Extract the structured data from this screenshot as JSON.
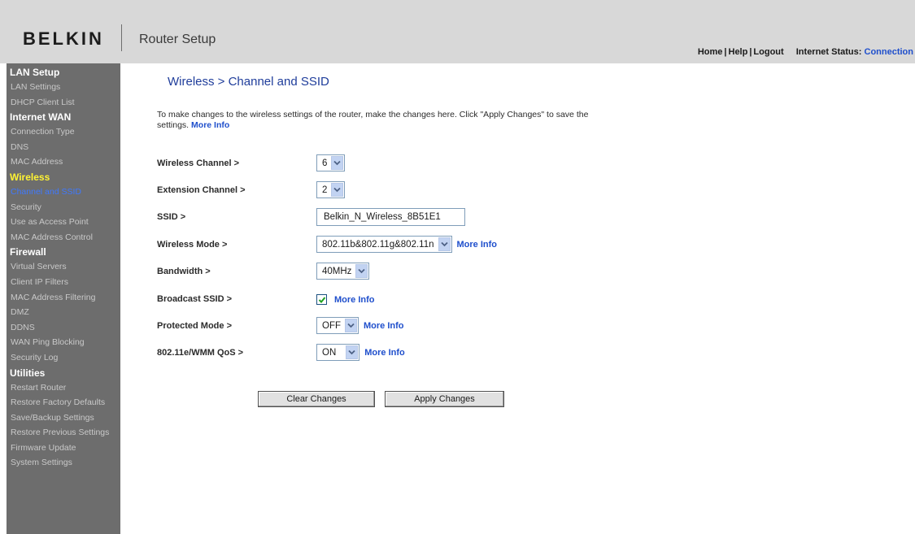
{
  "header": {
    "logo": "BELKIN",
    "title": "Router Setup",
    "nav": {
      "home": "Home",
      "help": "Help",
      "logout": "Logout",
      "separator": "|",
      "status_label": "Internet Status:",
      "status_value": "Connection"
    }
  },
  "sidebar": {
    "lan_setup": "LAN Setup",
    "lan_settings": "LAN Settings",
    "dhcp_client_list": "DHCP Client List",
    "internet_wan": "Internet WAN",
    "connection_type": "Connection Type",
    "dns": "DNS",
    "mac_address": "MAC Address",
    "wireless": "Wireless",
    "channel_and_ssid": "Channel and SSID",
    "security": "Security",
    "use_as_access_point": "Use as Access Point",
    "mac_address_control": "MAC Address Control",
    "firewall": "Firewall",
    "virtual_servers": "Virtual Servers",
    "client_ip_filters": "Client IP Filters",
    "mac_address_filtering": "MAC Address Filtering",
    "dmz": "DMZ",
    "ddns": "DDNS",
    "wan_ping_blocking": "WAN Ping Blocking",
    "security_log": "Security Log",
    "utilities": "Utilities",
    "restart_router": "Restart Router",
    "restore_factory_defaults": "Restore Factory Defaults",
    "save_backup_settings": "Save/Backup Settings",
    "restore_previous_settings": "Restore Previous Settings",
    "firmware_update": "Firmware Update",
    "system_settings": "System Settings"
  },
  "main": {
    "title": "Wireless > Channel and SSID",
    "intro": "To make changes to the wireless settings of the router, make the changes here. Click \"Apply Changes\" to save the settings.",
    "more_info": "More Info",
    "fields": {
      "wireless_channel": {
        "label": "Wireless Channel >",
        "value": "6"
      },
      "extension_channel": {
        "label": "Extension Channel >",
        "value": "2"
      },
      "ssid": {
        "label": "SSID >",
        "value": "Belkin_N_Wireless_8B51E1"
      },
      "wireless_mode": {
        "label": "Wireless Mode >",
        "value": "802.11b&802.11g&802.11n"
      },
      "bandwidth": {
        "label": "Bandwidth >",
        "value": "40MHz"
      },
      "broadcast_ssid": {
        "label": "Broadcast SSID >",
        "checked": true
      },
      "protected_mode": {
        "label": "Protected Mode >",
        "value": "OFF"
      },
      "wmm_qos": {
        "label": "802.11e/WMM QoS >",
        "value": "ON"
      }
    },
    "buttons": {
      "clear": "Clear Changes",
      "apply": "Apply Changes"
    }
  },
  "colors": {
    "header_bg": "#d8d8d8",
    "sidebar_bg": "#6d6d6d",
    "sidebar_active_group": "#fff333",
    "sidebar_active_item": "#3f79ff",
    "link": "#1f4fcc",
    "title": "#1f3d9b"
  }
}
